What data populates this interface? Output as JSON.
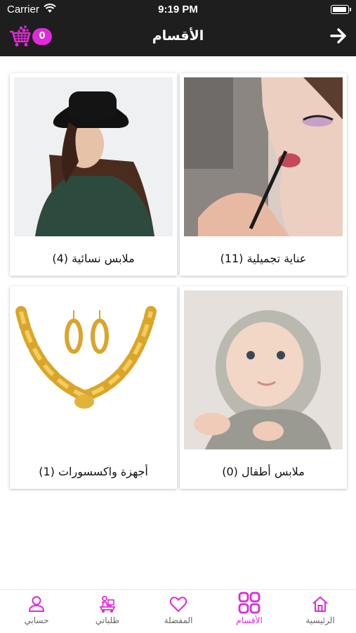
{
  "status_bar": {
    "carrier": "Carrier",
    "time": "9:19 PM"
  },
  "header": {
    "title": "الأقسام",
    "cart_count": "0"
  },
  "categories": [
    {
      "label": "عناية تجميلية (11)",
      "image": "makeup-photo"
    },
    {
      "label": "ملابس نسائية (4)",
      "image": "woman-hat-photo"
    },
    {
      "label": "ملابس أطفال (0)",
      "image": "baby-photo"
    },
    {
      "label": "أجهزة واكسسورات (1)",
      "image": "gold-jewelry-photo"
    }
  ],
  "tabs": [
    {
      "label": "الرئيسية",
      "icon": "home-icon",
      "active": false
    },
    {
      "label": "الأقسام",
      "icon": "categories-icon",
      "active": true
    },
    {
      "label": "المفضلة",
      "icon": "heart-icon",
      "active": false
    },
    {
      "label": "طلباتي",
      "icon": "delivery-icon",
      "active": false
    },
    {
      "label": "حسابي",
      "icon": "user-icon",
      "active": false
    }
  ],
  "colors": {
    "accent": "#e02ad8",
    "header_bg": "#1e1e1e"
  }
}
